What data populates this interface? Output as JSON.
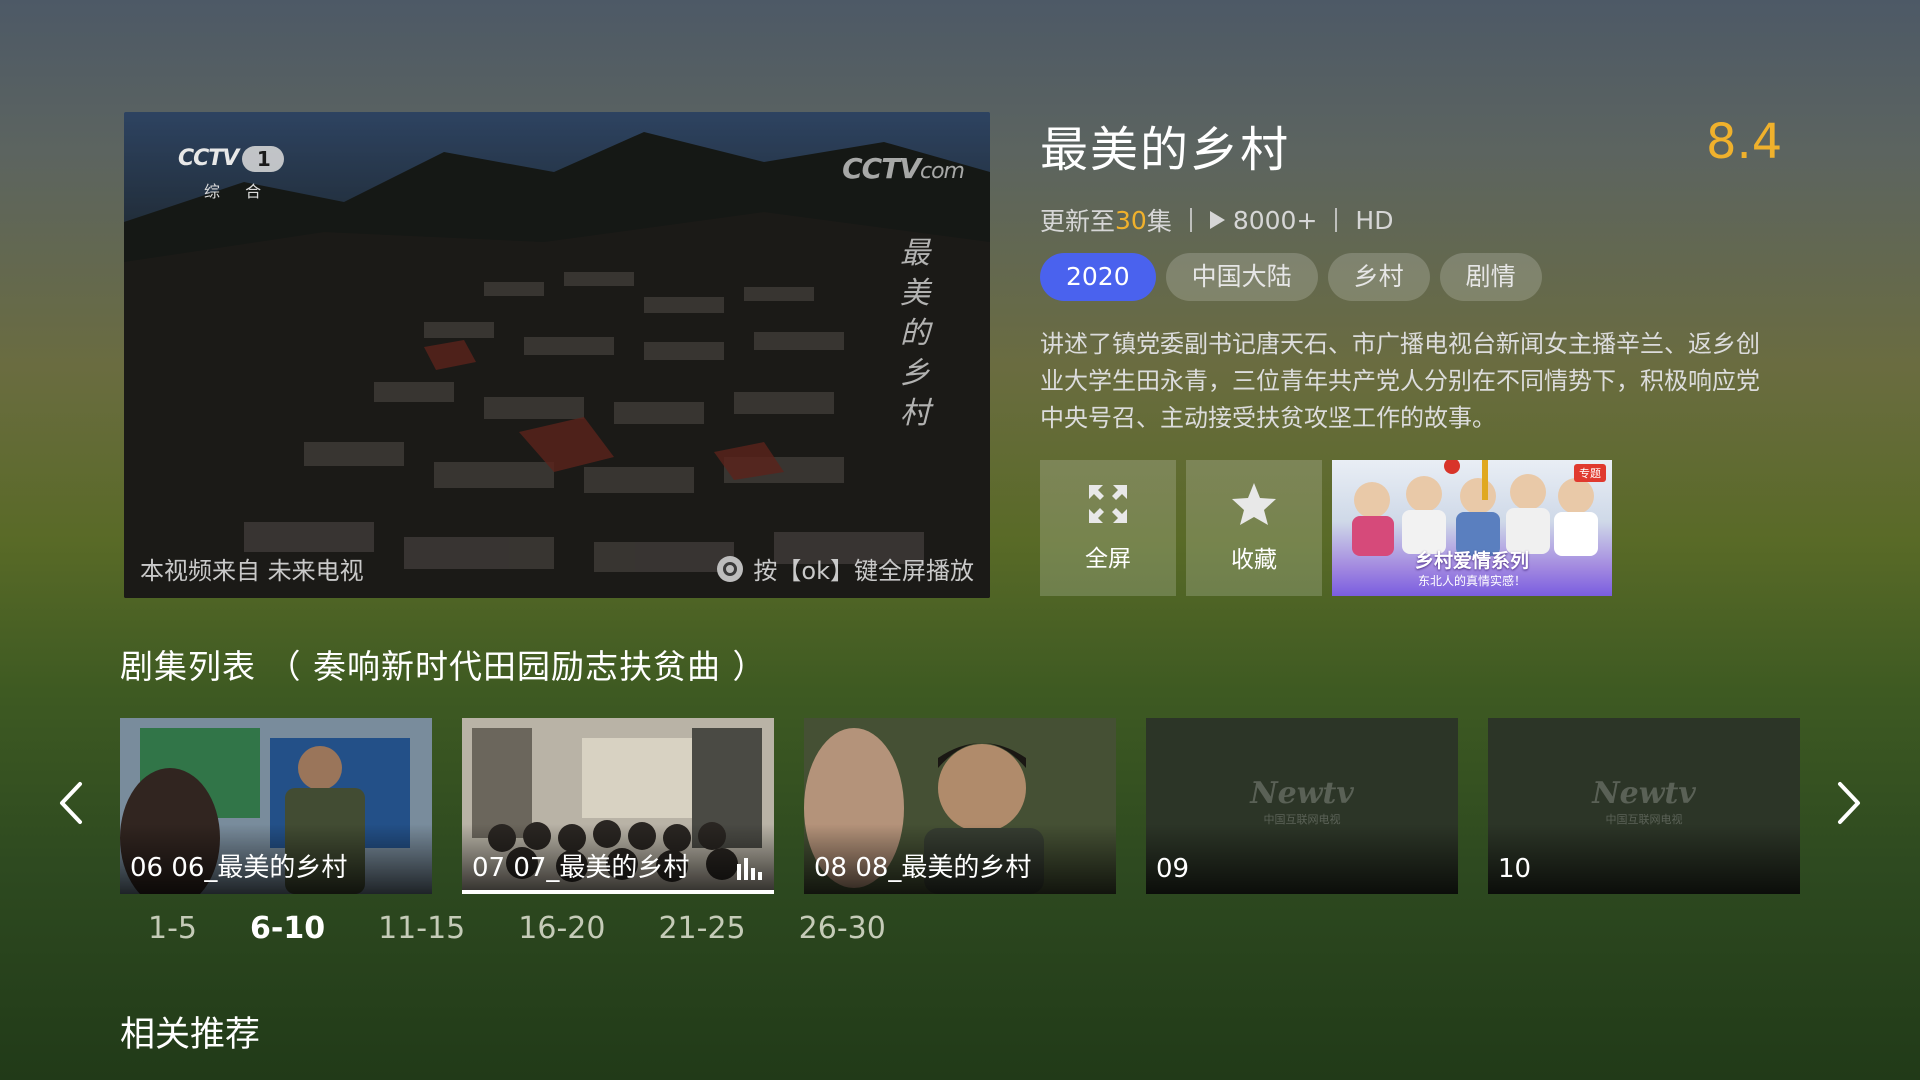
{
  "preview": {
    "channel_logo": "CCTV",
    "channel_number": "1",
    "channel_sub": "综 合",
    "watermark_logo": "CCTV",
    "watermark_suffix": "com",
    "vertical_title": [
      "最",
      "美",
      "的",
      "乡",
      "村"
    ],
    "source_text": "本视频来自 未来电视",
    "fullscreen_hint": "按【ok】键全屏播放"
  },
  "detail": {
    "title": "最美的乡村",
    "score": "8.4",
    "update_prefix": "更新至",
    "update_count": "30",
    "update_suffix": "集",
    "play_count": "8000+",
    "quality": "HD",
    "tags": [
      "2020",
      "中国大陆",
      "乡村",
      "剧情"
    ],
    "active_tag_index": 0,
    "description": "讲述了镇党委副书记唐天石、市广播电视台新闻女主播辛兰、返乡创业大学生田永青，三位青年共产党人分别在不同情势下，积极响应党中央号召、主动接受扶贫攻坚工作的故事。"
  },
  "actions": {
    "fullscreen_label": "全屏",
    "favorite_label": "收藏"
  },
  "promo": {
    "badge": "专题",
    "title": "乡村爱情系列",
    "subtitle": "东北人的真情实感！"
  },
  "episode_section": {
    "title": "剧集列表 （ 奏响新时代田园励志扶贫曲 ）",
    "episodes": [
      {
        "label": "06 06_最美的乡村",
        "has_thumbnail": true,
        "playing": false
      },
      {
        "label": "07 07_最美的乡村",
        "has_thumbnail": true,
        "playing": true
      },
      {
        "label": "08 08_最美的乡村",
        "has_thumbnail": true,
        "playing": false
      },
      {
        "label": "09",
        "has_thumbnail": false,
        "playing": false
      },
      {
        "label": "10",
        "has_thumbnail": false,
        "playing": false
      }
    ],
    "placeholder_logo": "Newtv",
    "placeholder_sub": "中国互联网电视",
    "ranges": [
      "1-5",
      "6-10",
      "11-15",
      "16-20",
      "21-25",
      "26-30"
    ],
    "active_range_index": 1
  },
  "related": {
    "title": "相关推荐"
  },
  "colors": {
    "accent_blue": "#4a62ee",
    "score_gold": "#f0b12c"
  },
  "icons": {
    "fullscreen": "expand-arrows-icon",
    "favorite": "star-icon",
    "prev": "chevron-left-icon",
    "next": "chevron-right-icon",
    "playing": "equalizer-bars-icon",
    "play": "play-triangle-icon",
    "remote": "remote-ok-icon"
  }
}
